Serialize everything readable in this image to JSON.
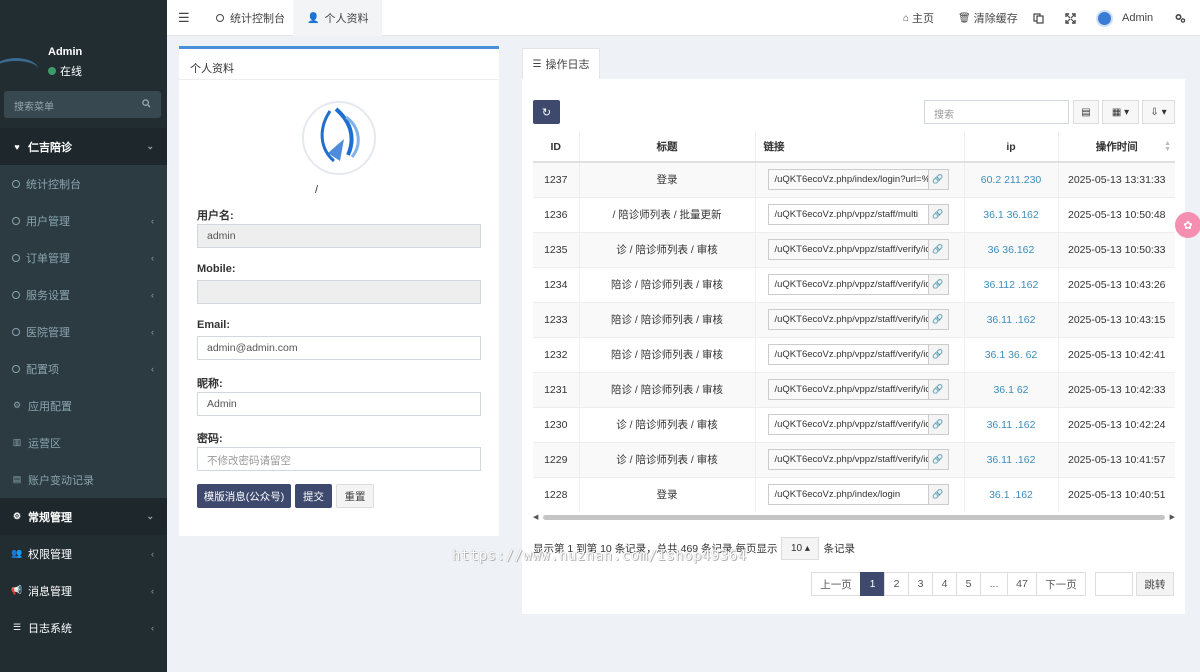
{
  "sidebar": {
    "user": {
      "name": "Admin",
      "status": "在线"
    },
    "search_placeholder": "搜索菜单",
    "group_main": "仁吉陪诊",
    "items": [
      {
        "label": "统计控制台",
        "arrow": false
      },
      {
        "label": "用户管理",
        "arrow": true
      },
      {
        "label": "订单管理",
        "arrow": true
      },
      {
        "label": "服务设置",
        "arrow": true
      },
      {
        "label": "医院管理",
        "arrow": true
      },
      {
        "label": "配置项",
        "arrow": true
      },
      {
        "label": "应用配置",
        "arrow": false
      },
      {
        "label": "运营区",
        "arrow": false
      },
      {
        "label": "账户变动记录",
        "arrow": false
      }
    ],
    "groups": [
      {
        "label": "常规管理"
      },
      {
        "label": "权限管理"
      },
      {
        "label": "消息管理"
      },
      {
        "label": "日志系统"
      }
    ]
  },
  "topbar": {
    "tabs": [
      {
        "label": "统计控制台"
      },
      {
        "label": "个人资料"
      }
    ],
    "home": "主页",
    "clear_cache": "清除缓存",
    "admin": "Admin"
  },
  "profile": {
    "title": "个人资料",
    "username_label": "用户名:",
    "username_value": "admin",
    "mobile_label": "Mobile:",
    "mobile_value": "",
    "email_label": "Email:",
    "email_value": "admin@admin.com",
    "nickname_label": "昵称:",
    "nickname_value": "Admin",
    "password_label": "密码:",
    "password_placeholder": "不修改密码请留空",
    "btn_template": "模版消息(公众号)",
    "btn_submit": "提交",
    "btn_reset": "重置"
  },
  "log": {
    "tab": "操作日志",
    "search_placeholder": "搜索",
    "columns": {
      "id": "ID",
      "title": "标题",
      "link": "链接",
      "ip": "ip",
      "time": "操作时间"
    },
    "rows": [
      {
        "id": "1237",
        "title": "登录",
        "link": "/uQKT6ecoVz.php/index/login?url=%",
        "ip": "60.2 211.230",
        "time": "2025-05-13 13:31:33"
      },
      {
        "id": "1236",
        "title": "/ 陪诊师列表 / 批量更新",
        "link": "/uQKT6ecoVz.php/vppz/staff/multi",
        "ip": "36.1 36.162",
        "time": "2025-05-13 10:50:48"
      },
      {
        "id": "1235",
        "title": "诊 / 陪诊师列表 / 审核",
        "link": "/uQKT6ecoVz.php/vppz/staff/verify/ic",
        "ip": "36 36.162",
        "time": "2025-05-13 10:50:33"
      },
      {
        "id": "1234",
        "title": "陪诊 / 陪诊师列表 / 审核",
        "link": "/uQKT6ecoVz.php/vppz/staff/verify/ic",
        "ip": "36.112 .162",
        "time": "2025-05-13 10:43:26"
      },
      {
        "id": "1233",
        "title": "陪诊 / 陪诊师列表 / 审核",
        "link": "/uQKT6ecoVz.php/vppz/staff/verify/ic",
        "ip": "36.11 .162",
        "time": "2025-05-13 10:43:15"
      },
      {
        "id": "1232",
        "title": "陪诊 / 陪诊师列表 / 审核",
        "link": "/uQKT6ecoVz.php/vppz/staff/verify/ic",
        "ip": "36.1 36. 62",
        "time": "2025-05-13 10:42:41"
      },
      {
        "id": "1231",
        "title": "陪诊 / 陪诊师列表 / 审核",
        "link": "/uQKT6ecoVz.php/vppz/staff/verify/ic",
        "ip": "36.1 62",
        "time": "2025-05-13 10:42:33"
      },
      {
        "id": "1230",
        "title": "诊 / 陪诊师列表 / 审核",
        "link": "/uQKT6ecoVz.php/vppz/staff/verify/ic",
        "ip": "36.11 .162",
        "time": "2025-05-13 10:42:24"
      },
      {
        "id": "1229",
        "title": "诊 / 陪诊师列表 / 审核",
        "link": "/uQKT6ecoVz.php/vppz/staff/verify/ic",
        "ip": "36.11 .162",
        "time": "2025-05-13 10:41:57"
      },
      {
        "id": "1228",
        "title": "登录",
        "link": "/uQKT6ecoVz.php/index/login",
        "ip": "36.1 .162",
        "time": "2025-05-13 10:40:51"
      }
    ],
    "info_prefix": "显示第 1 到第 10 条记录，总共 469 条记录 每页显示",
    "page_size": "10",
    "info_suffix": "条记录",
    "pager": {
      "prev": "上一页",
      "pages": [
        "1",
        "2",
        "3",
        "4",
        "5",
        "...",
        "47"
      ],
      "next": "下一页",
      "jump": "跳转"
    }
  },
  "watermark": "https://www.huzhan.com/ishop49364",
  "accent_color": "#3d4a6e",
  "sidebar_color": "#222d32"
}
